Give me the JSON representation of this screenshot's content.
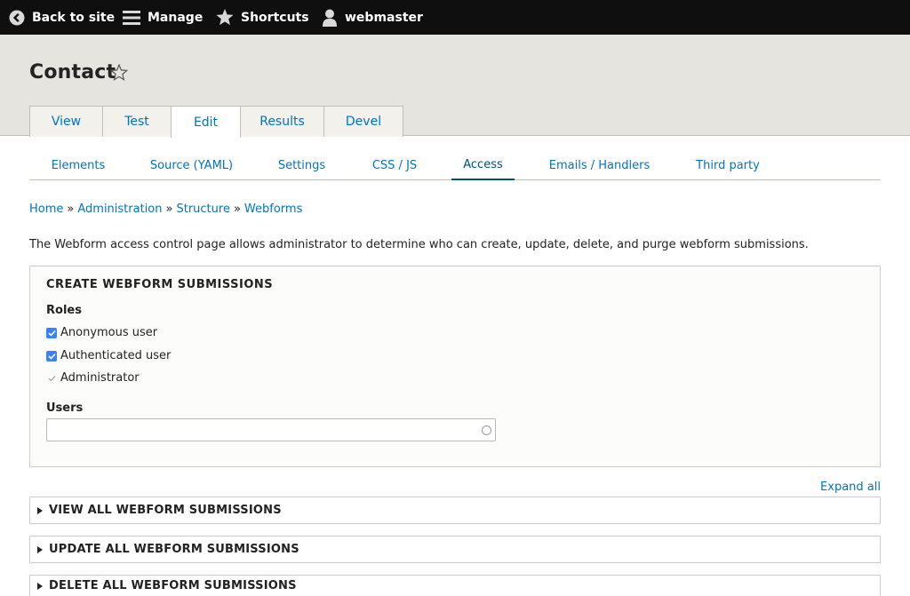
{
  "toolbar": {
    "back_label": "Back to site",
    "manage_label": "Manage",
    "shortcuts_label": "Shortcuts",
    "user_label": "webmaster"
  },
  "page": {
    "title": "Contact"
  },
  "primary_tabs": [
    {
      "label": "View"
    },
    {
      "label": "Test"
    },
    {
      "label": "Edit"
    },
    {
      "label": "Results"
    },
    {
      "label": "Devel"
    }
  ],
  "secondary_tabs": [
    {
      "label": "Elements"
    },
    {
      "label": "Source (YAML)"
    },
    {
      "label": "Settings"
    },
    {
      "label": "CSS / JS"
    },
    {
      "label": "Access"
    },
    {
      "label": "Emails / Handlers"
    },
    {
      "label": "Third party"
    }
  ],
  "active_primary_tab": "Edit",
  "active_secondary_tab": "Access",
  "breadcrumb": {
    "items": [
      "Home",
      "Administration",
      "Structure",
      "Webforms"
    ],
    "separator": "»"
  },
  "description": "The Webform access control page allows administrator to determine who can create, update, delete, and purge webform submissions.",
  "create_fieldset": {
    "legend": "CREATE WEBFORM SUBMISSIONS",
    "roles_label": "Roles",
    "roles": [
      {
        "label": "Anonymous user",
        "checked": true,
        "disabled": false
      },
      {
        "label": "Authenticated user",
        "checked": true,
        "disabled": false
      },
      {
        "label": "Administrator",
        "checked": true,
        "disabled": true
      }
    ],
    "users_label": "Users",
    "users_value": ""
  },
  "expand_all_label": "Expand all",
  "collapsed_sections": [
    {
      "label": "VIEW ALL WEBFORM SUBMISSIONS"
    },
    {
      "label": "UPDATE ALL WEBFORM SUBMISSIONS"
    },
    {
      "label": "DELETE ALL WEBFORM SUBMISSIONS"
    }
  ],
  "colors": {
    "toolbar_bg": "#0f0f0f",
    "header_bg": "#e6e4df",
    "link": "#0074bd",
    "checkbox_on": "#3b82f6"
  },
  "icons": {
    "back": "chevron-left-circle-icon",
    "manage": "hamburger-menu-icon",
    "shortcuts": "star-icon",
    "user": "user-icon",
    "title_star": "star-outline-icon",
    "disclosure": "triangle-right-icon"
  }
}
